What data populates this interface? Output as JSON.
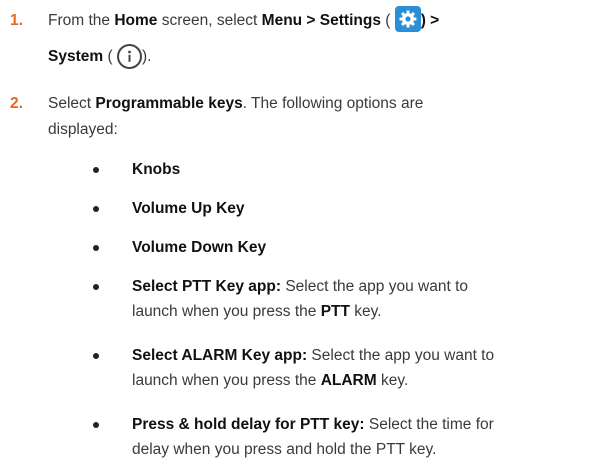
{
  "steps": [
    {
      "number": "1.",
      "parts": {
        "a": "From the ",
        "home": "Home",
        "b": " screen, select ",
        "menu_path": "Menu > Settings",
        "c": " (",
        "d": ") >",
        "system": "System",
        "e": " (",
        "f": ")."
      },
      "icons": [
        "settings-gear-icon",
        "info-icon"
      ]
    },
    {
      "number": "2.",
      "parts": {
        "a": "Select ",
        "keys": "Programmable keys",
        "b": ". The following options are",
        "c": "displayed:"
      }
    }
  ],
  "options": [
    {
      "label": "Knobs",
      "desc": ""
    },
    {
      "label": "Volume Up Key",
      "desc": ""
    },
    {
      "label": "Volume Down Key",
      "desc": ""
    },
    {
      "label": "Select PTT Key app:",
      "desc_1": " Select the app you want to",
      "desc_2a": "launch when you press the ",
      "desc_2b": "PTT",
      "desc_2c": " key."
    },
    {
      "label": "Select ALARM Key app:",
      "desc_1": " Select the app you want to",
      "desc_2a": "launch when you press the ",
      "desc_2b": "ALARM",
      "desc_2c": " key."
    },
    {
      "label": "Press & hold delay for PTT key:",
      "desc_1": " Select the time for",
      "desc_2": "delay when you press and hold the PTT key."
    }
  ],
  "colors": {
    "step_number": "#e8661e",
    "gear_icon_bg": "#2a8fd6"
  }
}
